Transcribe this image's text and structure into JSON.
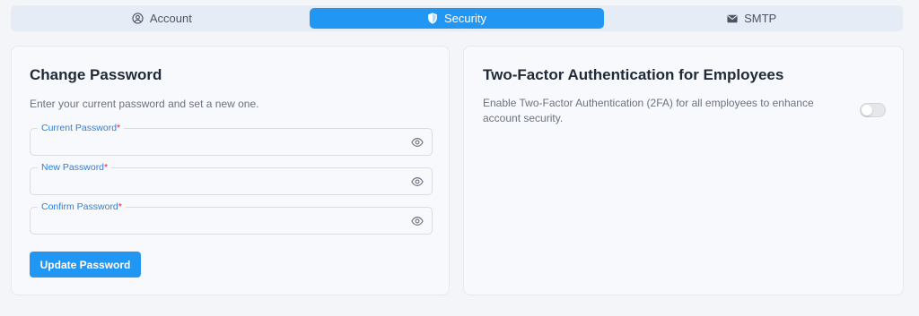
{
  "tabs": [
    {
      "label": "Account",
      "icon": "user-circle-icon"
    },
    {
      "label": "Security",
      "icon": "shield-icon"
    },
    {
      "label": "SMTP",
      "icon": "envelope-icon"
    }
  ],
  "active_tab": "Security",
  "change_password": {
    "title": "Change Password",
    "description": "Enter your current password and set a new one.",
    "fields": [
      {
        "label": "Current Password",
        "required_mark": "*",
        "value": ""
      },
      {
        "label": "New Password",
        "required_mark": "*",
        "value": ""
      },
      {
        "label": "Confirm Password",
        "required_mark": "*",
        "value": ""
      }
    ],
    "submit_label": "Update Password"
  },
  "two_factor": {
    "title": "Two-Factor Authentication for Employees",
    "description": "Enable Two-Factor Authentication (2FA) for all employees to enhance account security.",
    "enabled": false
  },
  "colors": {
    "accent": "#2196f3",
    "label": "#2b7fdc",
    "required": "#e11d48"
  }
}
